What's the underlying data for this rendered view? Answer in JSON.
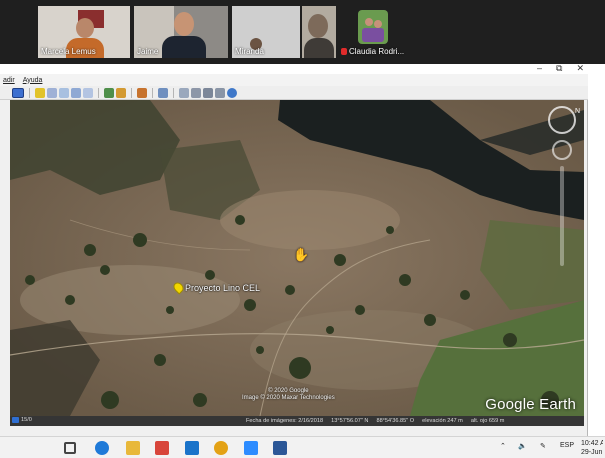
{
  "call": {
    "participants": [
      {
        "name": "Marcela Lemus",
        "muted": false
      },
      {
        "name": "Jaime",
        "muted": false
      },
      {
        "name": "Miranda",
        "muted": false
      },
      {
        "name": "",
        "muted": false
      },
      {
        "name": "Claudia Rodri...",
        "muted": true
      }
    ]
  },
  "window": {
    "controls": [
      "–",
      "⧉",
      "✕"
    ],
    "menu": [
      "adir",
      "Ayuda"
    ]
  },
  "map": {
    "placemark_label": "Proyecto Lino CEL",
    "copyright_line1": "© 2020 Google",
    "copyright_line2": "Image © 2020 Maxar Technologies",
    "brand": "Google Earth",
    "compass_letter": "N"
  },
  "status": {
    "tour_label": "15/0",
    "date": "Fecha de imágenes: 2/16/2018",
    "lat": "13°57'56.07\" N",
    "lon": "88°54'36.85\" O",
    "elevation": "elevación  247 m",
    "eye_alt": "alt. ojo  659 m"
  },
  "taskbar": {
    "lang": "ESP",
    "time": "10:42 A",
    "date": "29-Jun"
  },
  "colors": {
    "call_bg": "#1f1f1f",
    "taskbar_bg": "#f2f2f2",
    "map_soil": "#7b6a55",
    "water": "#1b2020"
  }
}
